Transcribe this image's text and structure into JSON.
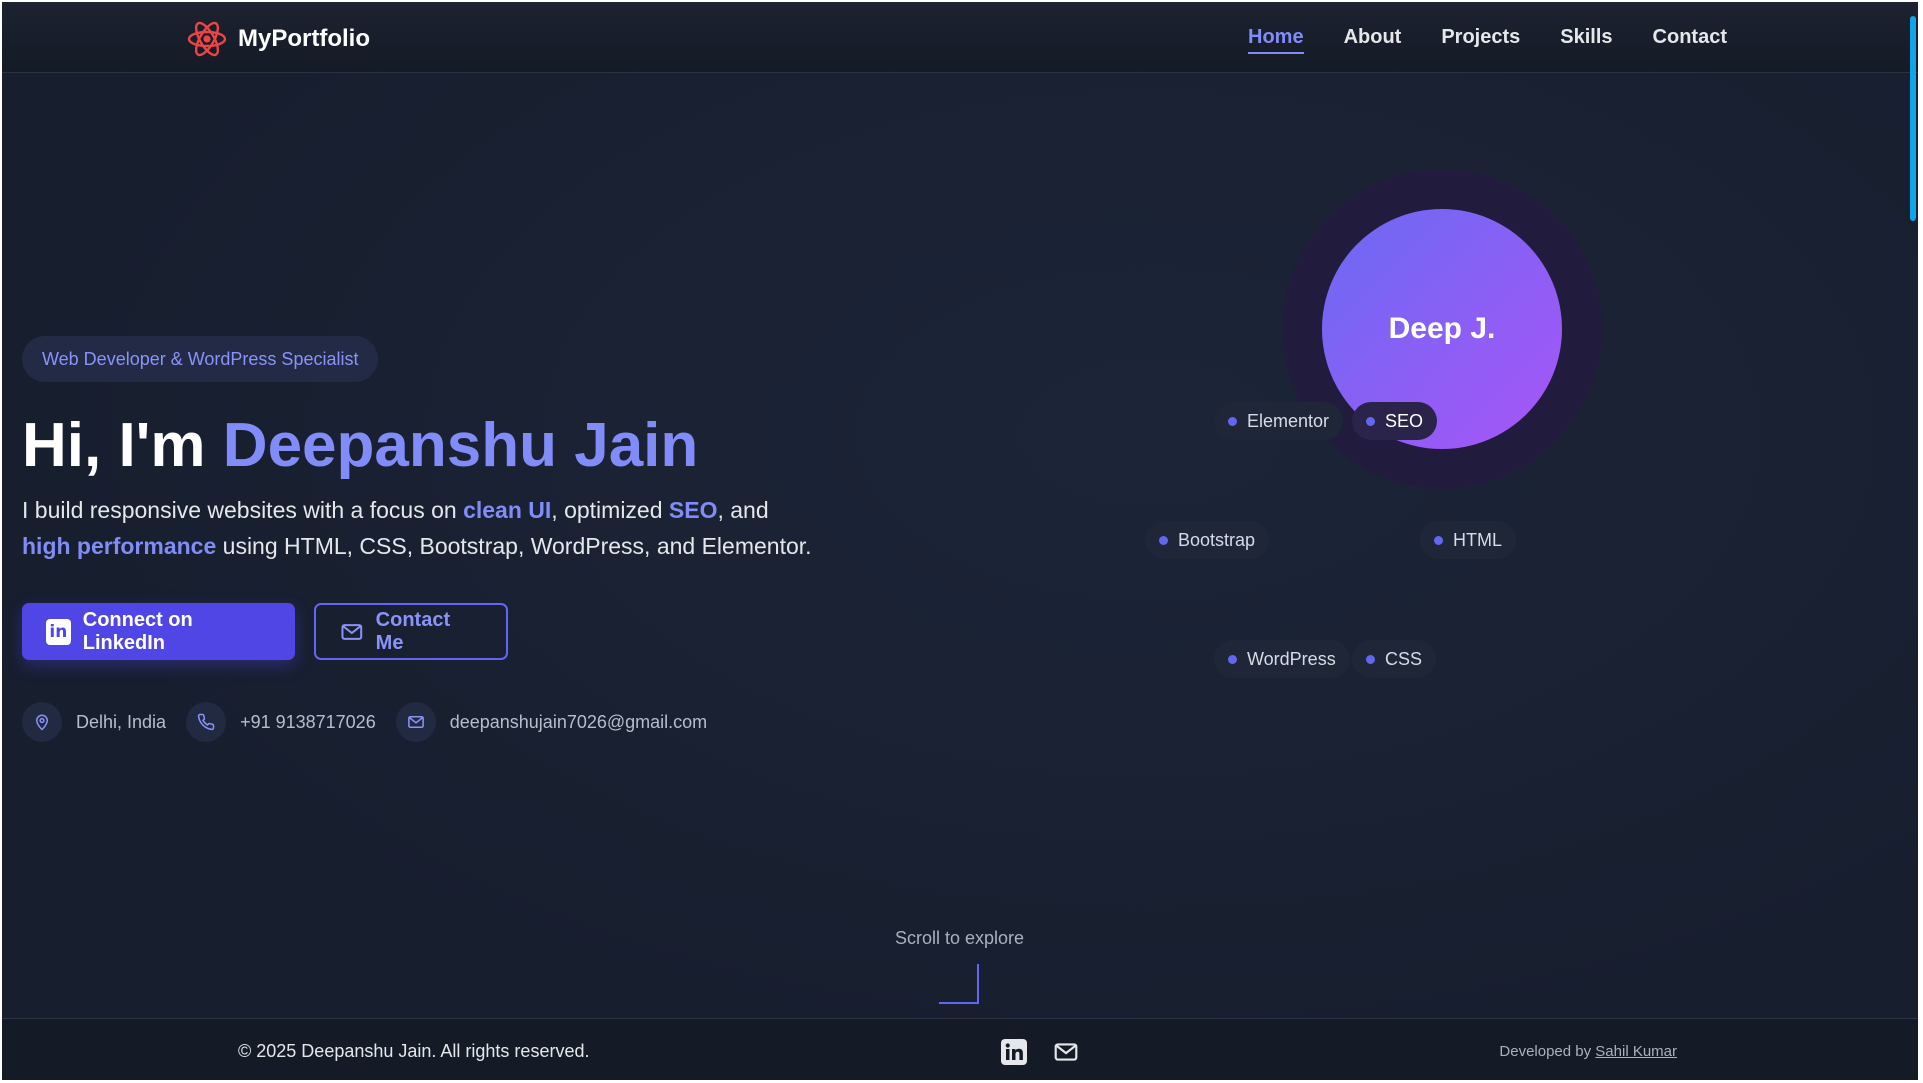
{
  "brand": {
    "name": "MyPortfolio",
    "logo_icon": "atom-icon"
  },
  "nav": {
    "items": [
      "Home",
      "About",
      "Projects",
      "Skills",
      "Contact"
    ],
    "active": "Home"
  },
  "hero": {
    "badge": "Web Developer & WordPress Specialist",
    "greeting": "Hi, I'm",
    "name": "Deepanshu Jain",
    "intro": {
      "part1": "I build responsive websites with a focus on",
      "hl1": "clean UI",
      "part2": ", optimized",
      "hl2": "SEO",
      "part3": ", and",
      "hl3": "high performance",
      "part4": "using HTML, CSS, Bootstrap, WordPress, and Elementor."
    },
    "buttons": {
      "linkedin": "Connect on LinkedIn",
      "contact": "Contact Me"
    },
    "contacts": {
      "location": "Delhi, India",
      "phone": "+91 9138717026",
      "email": "deepanshujain7026@gmail.com"
    }
  },
  "avatar": {
    "initials": "Deep J."
  },
  "skills": {
    "elementor": "Elementor",
    "seo": "SEO",
    "bootstrap": "Bootstrap",
    "html": "HTML",
    "wordpress": "WordPress",
    "css": "CSS"
  },
  "scroll_hint": "Scroll to explore",
  "footer": {
    "copyright": "© 2025 Deepanshu Jain. All rights reserved.",
    "credit_prefix": "Developed by",
    "credit_name": "Sahil Kumar"
  },
  "colors": {
    "accent": "#818cf8",
    "primary": "#4f46e5",
    "background": "#182032",
    "avatar_gradient_start": "#6a6af2",
    "avatar_gradient_end": "#a855f7",
    "scrollbar": "#0ea5e9",
    "logo": "#ef4444"
  }
}
